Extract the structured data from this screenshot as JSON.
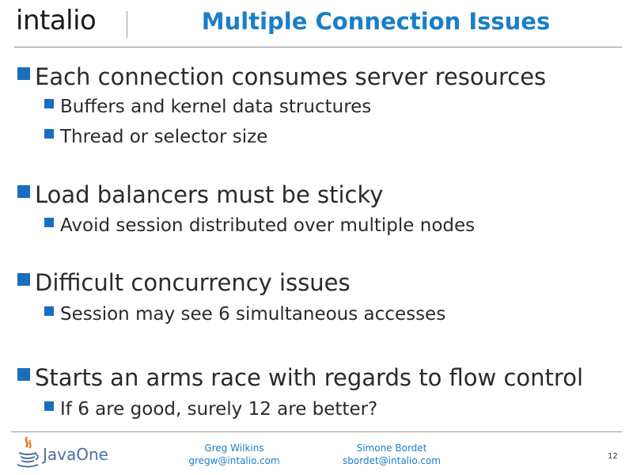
{
  "header": {
    "logo": "intalio",
    "title": "Multiple Connection Issues"
  },
  "bullets": [
    {
      "text": "Each connection consumes server resources",
      "sub": [
        "Buffers and kernel data structures",
        "Thread or selector size"
      ]
    },
    {
      "text": "Load balancers must be sticky",
      "sub": [
        "Avoid session distributed over multiple nodes"
      ]
    },
    {
      "text": "Difficult concurrency issues",
      "sub": [
        "Session may see 6 simultaneous accesses"
      ]
    },
    {
      "text": "Starts an arms race with regards to flow control",
      "sub": [
        "If 6 are good, surely 12 are better?"
      ]
    }
  ],
  "footer": {
    "brand": "JavaOne",
    "authors": [
      {
        "name": "Greg Wilkins",
        "email": "gregw@intalio.com"
      },
      {
        "name": "Simone Bordet",
        "email": "sbordet@intalio.com"
      }
    ],
    "page_number": "12"
  },
  "colors": {
    "title": "#1a7ec8",
    "bullet": "#1a6ec0",
    "footer_text": "#1a7ec8"
  }
}
